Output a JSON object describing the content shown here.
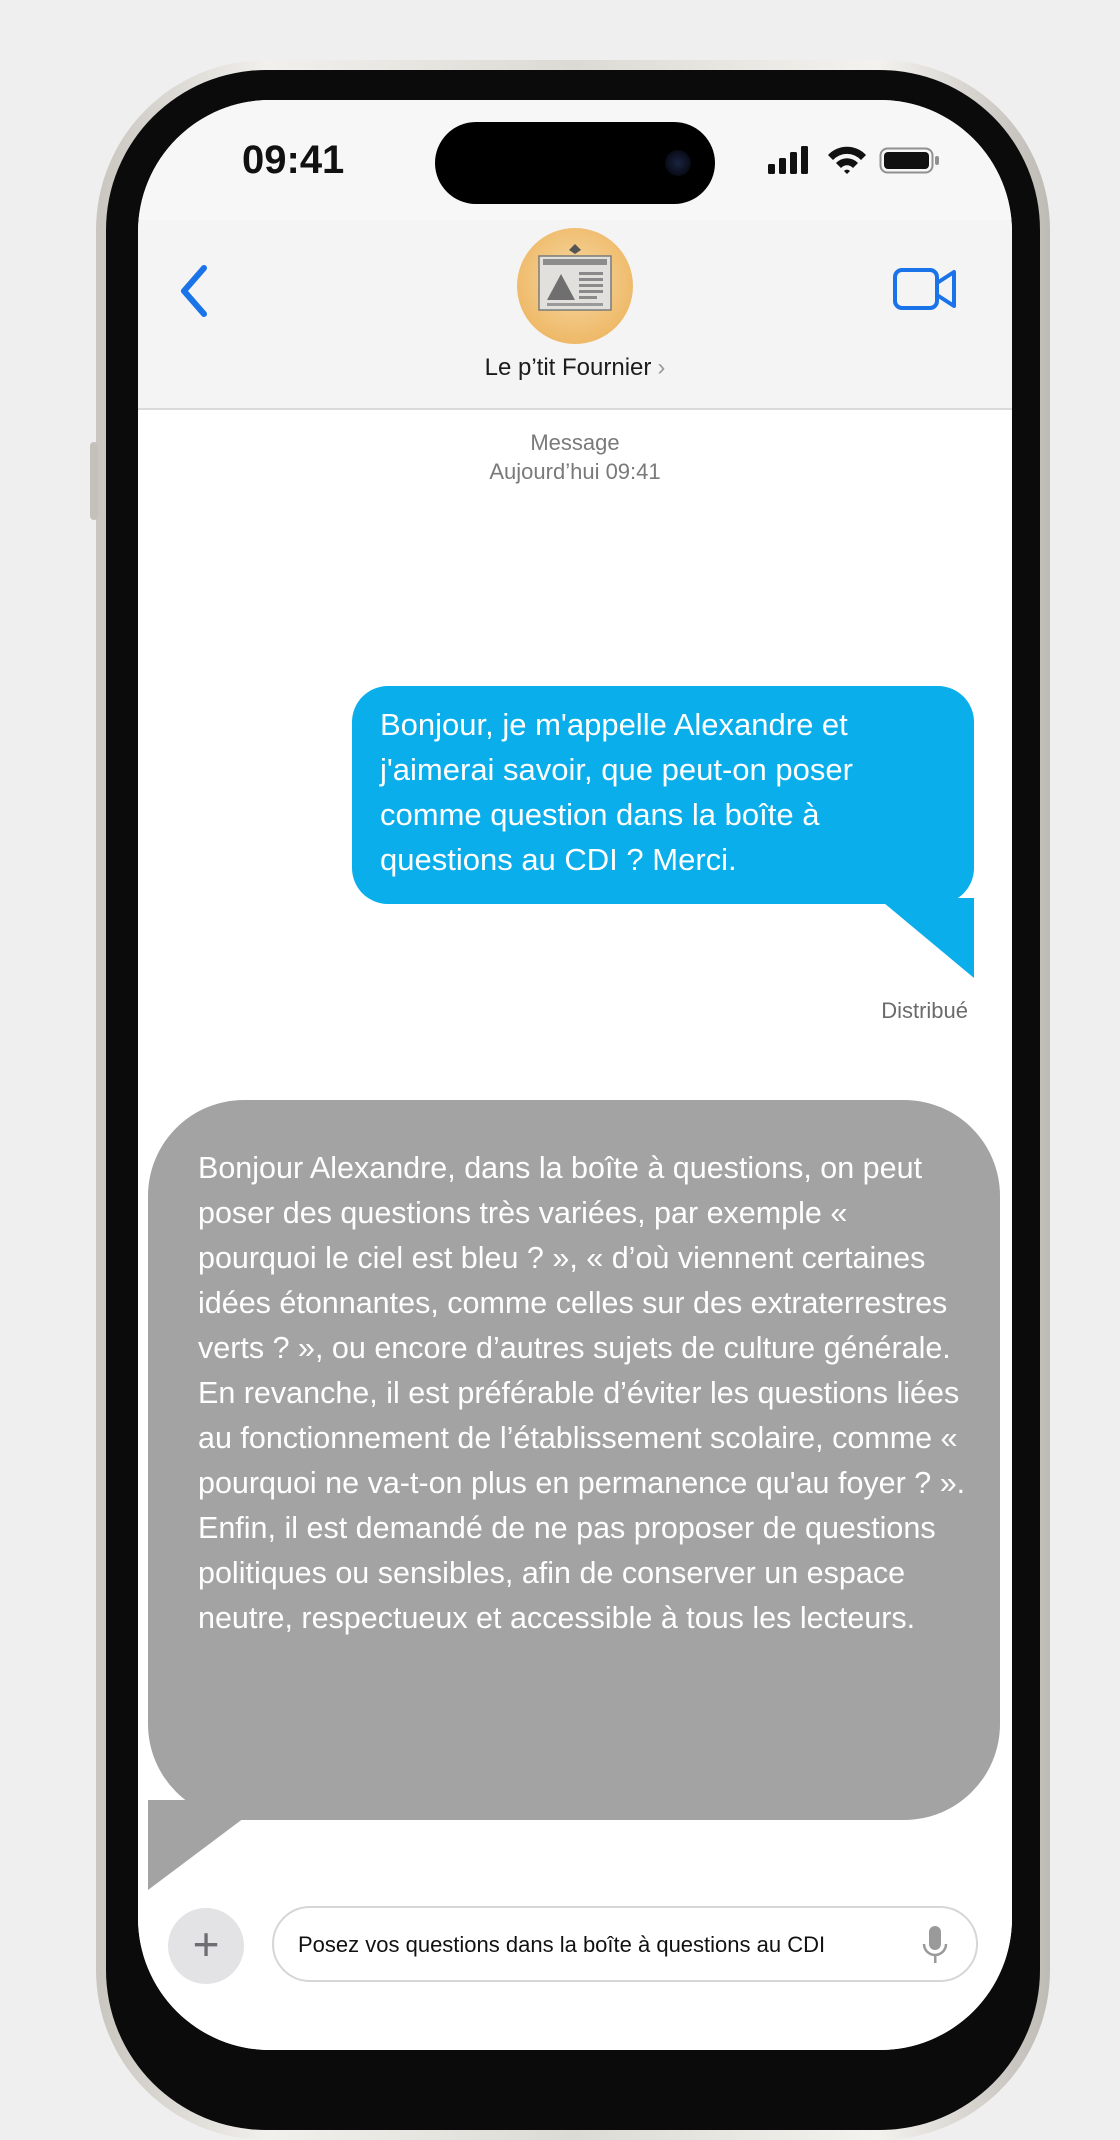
{
  "status_bar": {
    "time": "09:41"
  },
  "header": {
    "contact_name": "Le p’tit Fournier",
    "contact_chevron": "›"
  },
  "conversation": {
    "service_label": "Message",
    "timestamp": "Aujourd’hui 09:41",
    "outgoing_message": "Bonjour, je m'appelle Alexandre et j'aimerai savoir, que peut-on poser comme question dans la boîte à questions au CDI ? Merci.",
    "delivery_status": "Distribué",
    "incoming_message": "Bonjour Alexandre, dans la boîte à questions, on peut poser des questions très variées, par exemple « pourquoi le ciel est bleu ? », « d’où viennent certaines idées étonnantes, comme celles sur des extraterrestres verts ? », ou encore d’autres sujets de culture générale. En revanche, il est préférable d’éviter les questions liées au fonctionnement de l’établissement scolaire, comme « pourquoi ne va-t-on plus en permanence qu'au foyer ? ». Enfin, il est demandé de ne pas proposer de questions politiques ou sensibles, afin de conserver un espace neutre, respectueux et accessible à tous les lecteurs."
  },
  "composer": {
    "plus_label": "+",
    "input_value": "Posez vos questions dans la boîte à questions au CDI"
  },
  "colors": {
    "outgoing_bubble": "#0aaeea",
    "incoming_bubble": "#a3a3a3",
    "ios_blue": "#1a73e8"
  },
  "icons": [
    "chevron-left-icon",
    "video-camera-icon",
    "signal-icon",
    "wifi-icon",
    "battery-icon",
    "plus-icon",
    "microphone-icon"
  ]
}
